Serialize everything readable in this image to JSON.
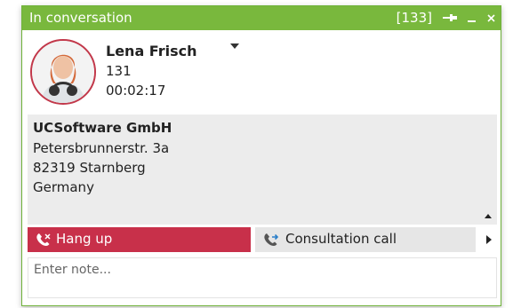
{
  "titlebar": {
    "title": "In conversation",
    "count": "[133]",
    "pin_icon": "pin-icon",
    "minimize_icon": "minimize-icon",
    "close_icon": "close-icon",
    "color": "#79b83d"
  },
  "contact": {
    "name": "Lena Frisch",
    "extension": "131",
    "duration": "00:02:17",
    "avatar_icon": "avatar",
    "dropdown_icon": "chevron-down-icon"
  },
  "address": {
    "company": "UCSoftware GmbH",
    "street": "Petersbrunnerstr. 3a",
    "city": "82319 Starnberg",
    "country": "Germany"
  },
  "actions": {
    "hangup_label": "Hang up",
    "hangup_color": "#c8304a",
    "consult_label": "Consultation call",
    "more_icon": "chevron-right-icon"
  },
  "note": {
    "placeholder": "Enter note..."
  }
}
